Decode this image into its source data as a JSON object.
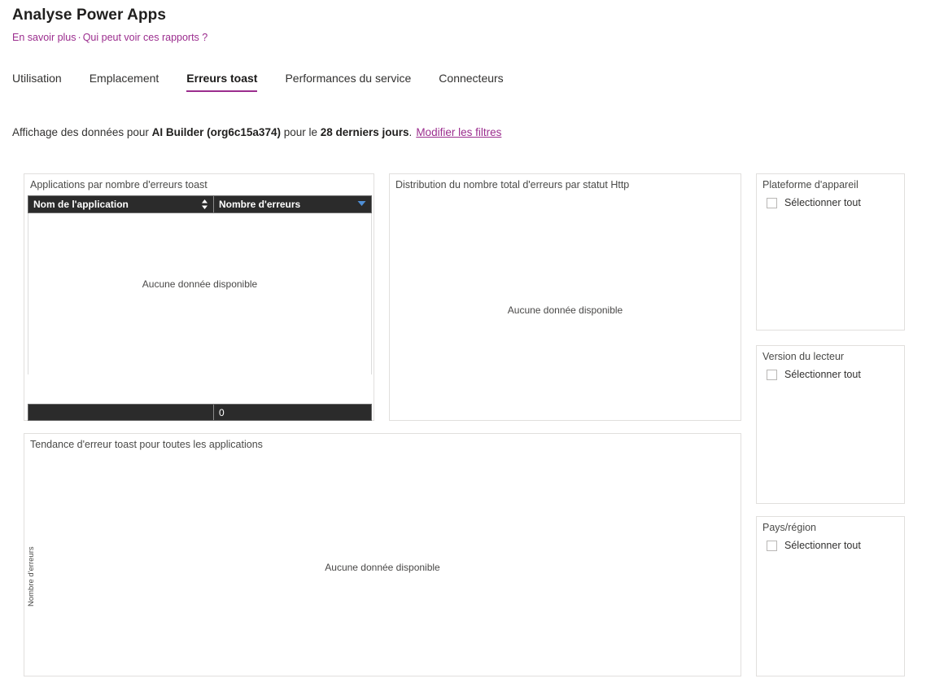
{
  "header": {
    "title": "Analyse Power Apps",
    "links": [
      {
        "label": "En savoir plus"
      },
      {
        "label": "Qui peut voir ces rapports ?"
      }
    ],
    "separator": "·"
  },
  "tabs": [
    {
      "label": "Utilisation",
      "active": false
    },
    {
      "label": "Emplacement",
      "active": false
    },
    {
      "label": "Erreurs toast",
      "active": true
    },
    {
      "label": "Performances du service",
      "active": false
    },
    {
      "label": "Connecteurs",
      "active": false
    }
  ],
  "filter_line": {
    "prefix": "Affichage des données pour ",
    "environment": "AI Builder (org6c15a374)",
    "middle": " pour le ",
    "period": "28 derniers jours",
    "suffix": ".",
    "edit_link": "Modifier les filtres"
  },
  "cards": {
    "apps_errors": {
      "title": "Applications par nombre d'erreurs toast",
      "columns": [
        {
          "label": "Nom de l'application",
          "sort": "both"
        },
        {
          "label": "Nombre d'erreurs",
          "sort": "desc"
        }
      ],
      "rows": [],
      "empty_message": "Aucune donnée disponible",
      "footer": {
        "col_a": "",
        "col_b": "0"
      }
    },
    "http_status": {
      "title": "Distribution du nombre total d'erreurs par statut Http",
      "empty_message": "Aucune donnée disponible"
    },
    "trend": {
      "title": "Tendance d'erreur toast pour toutes les applications",
      "y_axis_label": "Nombre d'erreurs",
      "empty_message": "Aucune donnée disponible"
    }
  },
  "filters": [
    {
      "title": "Plateforme d'appareil",
      "select_all_label": "Sélectionner tout",
      "checked": false
    },
    {
      "title": "Version du lecteur",
      "select_all_label": "Sélectionner tout",
      "checked": false
    },
    {
      "title": "Pays/région",
      "select_all_label": "Sélectionner tout",
      "checked": false
    }
  ],
  "colors": {
    "accent": "#9b2d8e",
    "table_header_bg": "#2b2b2b",
    "card_border": "#e1dfdd",
    "sort_desc": "#4f8fd6"
  },
  "chart_data": [
    {
      "type": "table",
      "title": "Applications par nombre d'erreurs toast",
      "columns": [
        "Nom de l'application",
        "Nombre d'erreurs"
      ],
      "rows": [],
      "totals": [
        "",
        "0"
      ],
      "note": "Aucune donnée disponible"
    },
    {
      "type": "bar",
      "title": "Distribution du nombre total d'erreurs par statut Http",
      "categories": [],
      "values": [],
      "xlabel": "",
      "ylabel": "",
      "note": "Aucune donnée disponible"
    },
    {
      "type": "line",
      "title": "Tendance d'erreur toast pour toutes les applications",
      "x": [],
      "values": [],
      "xlabel": "",
      "ylabel": "Nombre d'erreurs",
      "note": "Aucune donnée disponible"
    }
  ]
}
